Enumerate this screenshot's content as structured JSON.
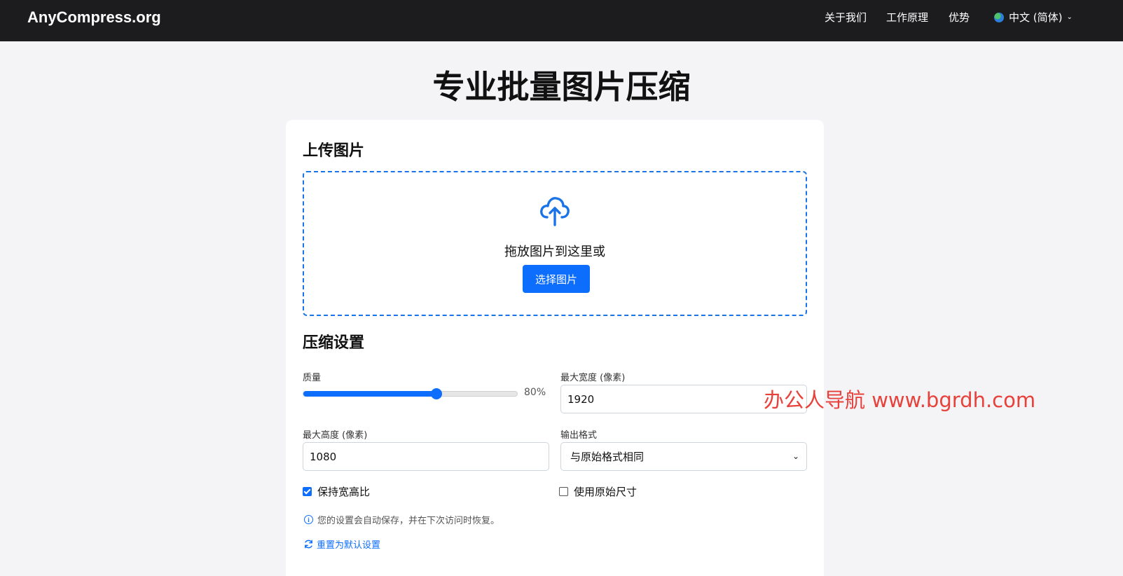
{
  "navbar": {
    "brand": "AnyCompress.org",
    "links": [
      "关于我们",
      "工作原理",
      "优势"
    ],
    "language": "中文 (简体)"
  },
  "page_title": "专业批量图片压缩",
  "upload": {
    "title": "上传图片",
    "drop_text": "拖放图片到这里或",
    "select_button": "选择图片",
    "icon": "cloud-upload-icon"
  },
  "settings": {
    "title": "压缩设置",
    "quality_label": "质量",
    "quality_value": 80,
    "quality_display": "80%",
    "max_width_label": "最大宽度 (像素)",
    "max_width_value": "1920",
    "max_height_label": "最大高度 (像素)",
    "max_height_value": "1080",
    "output_format_label": "输出格式",
    "output_format_value": "与原始格式相同",
    "keep_ratio_label": "保持宽高比",
    "keep_ratio_checked": true,
    "original_size_label": "使用原始尺寸",
    "original_size_checked": false,
    "note": "您的设置会自动保存，并在下次访问时恢复。",
    "reset_link": "重置为默认设置"
  },
  "watermark": "办公人导航 www.bgrdh.com",
  "colors": {
    "accent": "#0d6efd",
    "navbar_bg": "#1c1c1e",
    "page_bg": "#f4f4f6",
    "watermark": "#e8403a"
  }
}
